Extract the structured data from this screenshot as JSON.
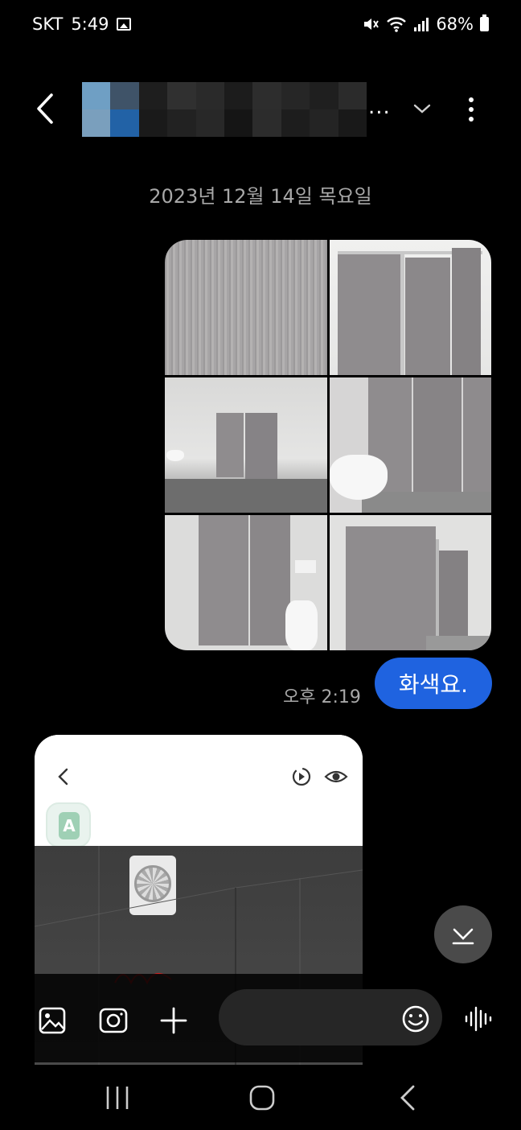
{
  "status_bar": {
    "carrier": "SKT",
    "time": "5:49",
    "battery": "68%",
    "icons": [
      "gallery-icon",
      "mute-icon",
      "wifi-icon",
      "signal-icon",
      "battery-icon"
    ]
  },
  "header": {
    "contact_name_suffix": "...",
    "icons": [
      "back-arrow-icon",
      "chevron-down-icon",
      "more-vert-icon"
    ]
  },
  "conversation": {
    "date_separator": "2023년 12월 14일 목요일",
    "sent_photos_count": 6,
    "sent_message": {
      "text": "화색요.",
      "time": "오후 2:19"
    }
  },
  "composer": {
    "placeholder": "",
    "icons": [
      "gallery-icon",
      "camera-icon",
      "plus-icon",
      "emoji-icon",
      "voice-wave-icon"
    ]
  },
  "colors": {
    "background": "#000000",
    "sent_bubble": "#1f63e0",
    "secondary_text": "#a8a8a8",
    "input_bg": "#262626"
  }
}
